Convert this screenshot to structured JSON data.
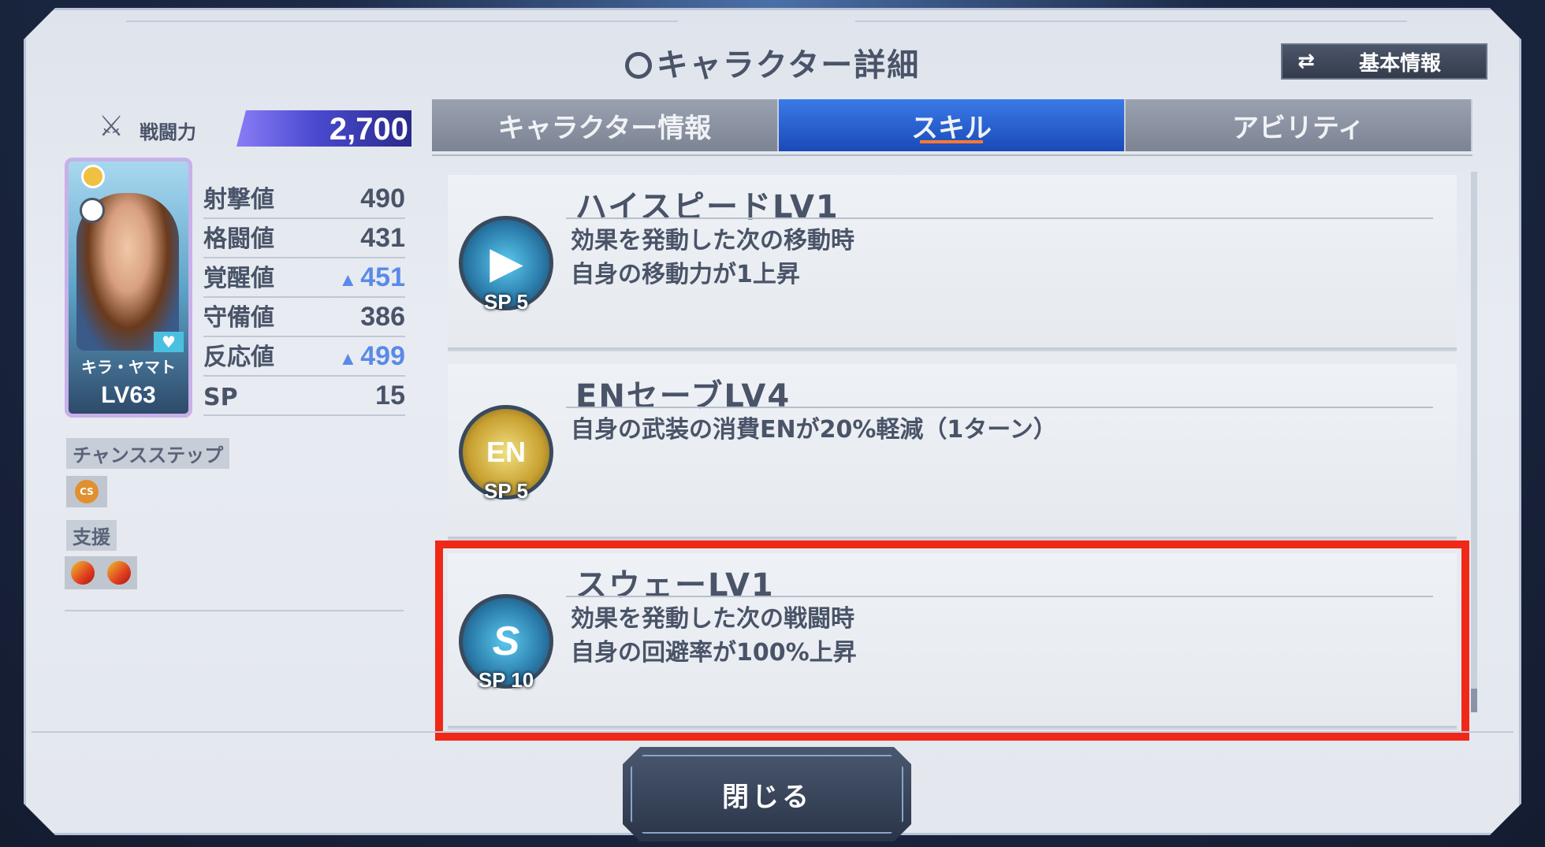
{
  "header": {
    "title": "キャラクター詳細",
    "basic_info_button": "基本情報"
  },
  "left": {
    "power_label": "戦闘力",
    "power_value": "2,700",
    "character": {
      "name": "キラ・ヤマト",
      "level": "LV63"
    },
    "stats": [
      {
        "label": "射撃値",
        "value": "490",
        "boosted": false
      },
      {
        "label": "格闘値",
        "value": "431",
        "boosted": false
      },
      {
        "label": "覚醒値",
        "value": "451",
        "boosted": true
      },
      {
        "label": "守備値",
        "value": "386",
        "boosted": false
      },
      {
        "label": "反応値",
        "value": "499",
        "boosted": true
      },
      {
        "label": "SP",
        "value": "15",
        "boosted": false
      }
    ],
    "chance_step_label": "チャンスステップ",
    "chance_step_icon": "CS",
    "support_label": "支援"
  },
  "tabs": [
    {
      "label": "キャラクター情報",
      "active": false
    },
    {
      "label": "スキル",
      "active": true
    },
    {
      "label": "アビリティ",
      "active": false
    }
  ],
  "skills": [
    {
      "name": "ハイスピードLV1",
      "desc_line1": "効果を発動した次の移動時",
      "desc_line2": "自身の移動力が1上昇",
      "sp": "SP 5",
      "icon": "speed-icon",
      "icon_glyph": "▶"
    },
    {
      "name": "ENセーブLV4",
      "desc_line1": "自身の武装の消費ENが20%軽減（1ターン）",
      "desc_line2": "",
      "sp": "SP 5",
      "icon": "en-battery-icon",
      "icon_glyph": "EN"
    },
    {
      "name": "スウェーLV1",
      "desc_line1": "効果を発動した次の戦闘時",
      "desc_line2": "自身の回避率が100%上昇",
      "sp": "SP 10",
      "icon": "sway-icon",
      "icon_glyph": "S"
    }
  ],
  "footer": {
    "close_button": "閉じる"
  },
  "colors": {
    "active_tab": "#2a5ad0",
    "highlight": "#f02818",
    "boost": "#5a8ae8"
  }
}
